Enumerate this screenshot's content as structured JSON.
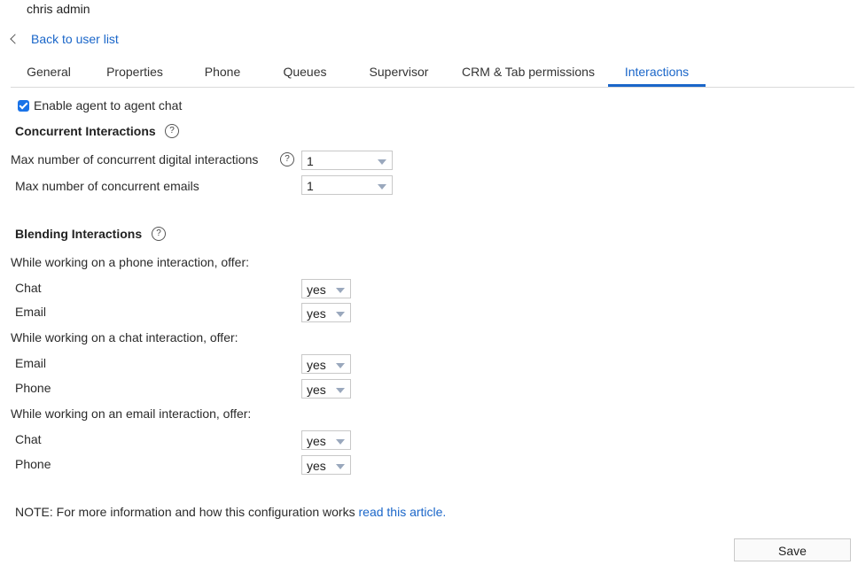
{
  "header": {
    "user_name": "chris admin",
    "back_label": "Back to user list"
  },
  "tabs": [
    {
      "label": "General"
    },
    {
      "label": "Properties"
    },
    {
      "label": "Phone"
    },
    {
      "label": "Queues"
    },
    {
      "label": "Supervisor"
    },
    {
      "label": "CRM & Tab permissions"
    },
    {
      "label": "Interactions",
      "active": true
    }
  ],
  "chat": {
    "enable_label": "Enable agent to agent chat",
    "checked": true
  },
  "concurrent": {
    "title": "Concurrent Interactions",
    "digital_label": "Max number of concurrent digital interactions",
    "digital_value": "1",
    "emails_label": "Max number of concurrent emails",
    "emails_value": "1"
  },
  "blending": {
    "title": "Blending Interactions",
    "phone_heading": "While working on a phone interaction, offer:",
    "phone_chat_label": "Chat",
    "phone_chat_value": "yes",
    "phone_email_label": "Email",
    "phone_email_value": "yes",
    "chat_heading": "While working on a chat interaction, offer:",
    "chat_email_label": "Email",
    "chat_email_value": "yes",
    "chat_phone_label": "Phone",
    "chat_phone_value": "yes",
    "email_heading": "While working on an email interaction, offer:",
    "email_chat_label": "Chat",
    "email_chat_value": "yes",
    "email_phone_label": "Phone",
    "email_phone_value": "yes"
  },
  "note": {
    "text": "NOTE: For more information and how this configuration works ",
    "link": "read this article."
  },
  "actions": {
    "save_label": "Save"
  },
  "colors": {
    "accent": "#1a66c9",
    "checkbox": "#1a73e8"
  }
}
